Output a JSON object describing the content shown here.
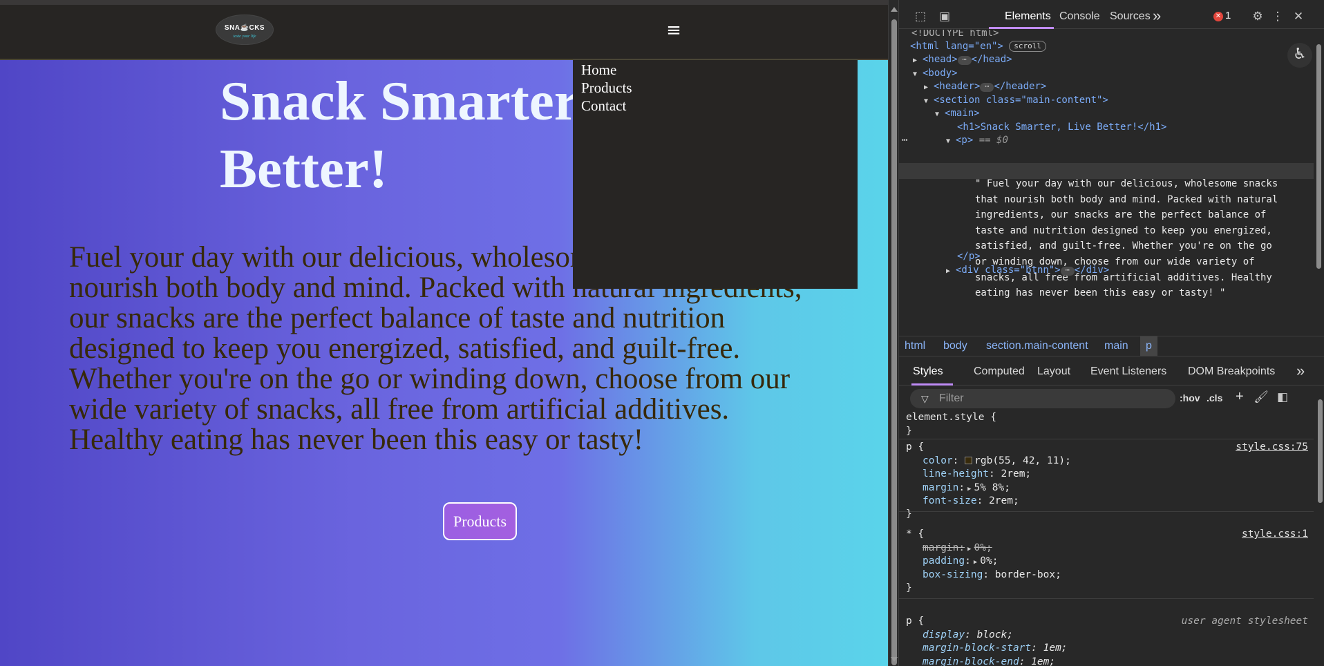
{
  "site": {
    "logo_text": "SNA☕CKS",
    "logo_tagline": "taste your life",
    "menu_icon": "≡",
    "nav": [
      "Home",
      "Products",
      "Contact"
    ],
    "headline": "Snack Smarter, Live Better!",
    "paragraph": "Fuel your day with our delicious, wholesome snacks that nourish both body and mind. Packed with natural ingredients, our snacks are the perfect balance of taste and nutrition designed to keep you energized, satisfied, and guilt-free. Whether you're on the go or winding down, choose from our wide variety of snacks, all free from artificial additives. Healthy eating has never been this easy or tasty!",
    "button_label": "Products",
    "colors": {
      "header_bg": "#272523",
      "gradient_start": "#5046c6",
      "gradient_end": "#5ad4ea",
      "text": "#37290b",
      "button": "#9b5fe2"
    }
  },
  "devtools": {
    "tabs": [
      "Elements",
      "Console",
      "Sources"
    ],
    "more_tabs": "»",
    "error_count": "1",
    "dom": {
      "doctype": "<!DOCTYPE html>",
      "html_open": "<html lang=\"en\">",
      "scroll_badge": "scroll",
      "head": "<head>",
      "head_close": "</head>",
      "body": "<body>",
      "header": "<header>",
      "header_close": "</header>",
      "section": "<section class=\"main-content\">",
      "main": "<main>",
      "h1": "<h1>Snack Smarter, Live Better!</h1>",
      "p_open": "<p>",
      "p_marker": "== $0",
      "p_text": "\" Fuel your day with our delicious, wholesome snacks\nthat nourish both body and mind. Packed with natural\ningredients, our snacks are the perfect balance of\ntaste and nutrition designed to keep you energized,\nsatisfied, and guilt-free. Whether you're on the go\nor winding down, choose from our wide variety of\nsnacks, all free from artificial additives. Healthy\neating has never been this easy or tasty! \"",
      "p_close": "</p>",
      "div": "<div class=\"btnn\">",
      "div_close": "</div>"
    },
    "breadcrumb": [
      "html",
      "body",
      "section.main-content",
      "main",
      "p"
    ],
    "style_tabs": [
      "Styles",
      "Computed",
      "Layout",
      "Event Listeners",
      "DOM Breakpoints"
    ],
    "filter_placeholder": "Filter",
    "filter_buttons": [
      ":hov",
      ".cls",
      "+"
    ],
    "rules": {
      "element_style": "element.style {",
      "close": "}",
      "p_selector": "p {",
      "p_source": "style.css:75",
      "p_color_prop": "color",
      "p_color_val": "rgb(55, 42, 11);",
      "p_lh_prop": "line-height",
      "p_lh_val": "2rem;",
      "p_margin_prop": "margin",
      "p_margin_val": "5% 8%;",
      "p_fs_prop": "font-size",
      "p_fs_val": "2rem;",
      "star_selector": "* {",
      "star_source": "style.css:1",
      "star_margin_prop": "margin",
      "star_margin_val": "0%;",
      "star_padding_prop": "padding",
      "star_padding_val": "0%;",
      "star_bs_prop": "box-sizing",
      "star_bs_val": "border-box;",
      "ua_selector": "p {",
      "ua_source": "user agent stylesheet",
      "ua_display_prop": "display",
      "ua_display_val": "block;",
      "ua_mbs_prop": "margin-block-start",
      "ua_mbs_val": "1em;",
      "ua_mbe_prop": "margin-block-end",
      "ua_mbe_val": "1em;"
    }
  }
}
